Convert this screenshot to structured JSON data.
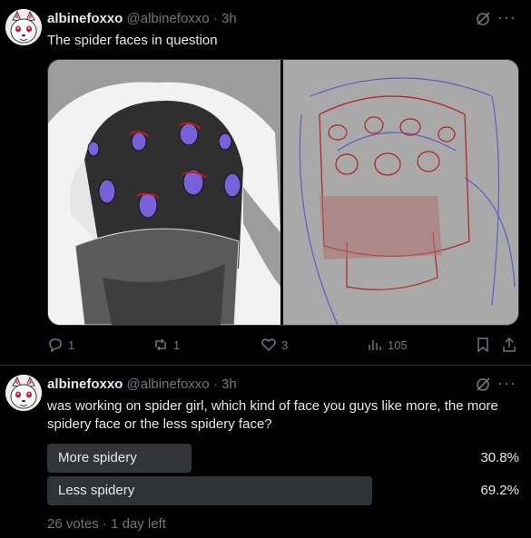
{
  "post1": {
    "author_name": "albinefoxxo",
    "handle": "@albinefoxxo",
    "separator": "·",
    "time": "3h",
    "more_label": "···",
    "text": "The spider faces in question",
    "stats": {
      "replies": "1",
      "reposts": "1",
      "likes": "3",
      "views": "105"
    }
  },
  "post2": {
    "author_name": "albinefoxxo",
    "handle": "@albinefoxxo",
    "separator": "·",
    "time": "3h",
    "more_label": "···",
    "text": "was working on spider girl, which kind of face you guys like more, the more spidery face or the less spidery face?",
    "poll": {
      "options": [
        {
          "label": "More spidery",
          "percent_text": "30.8%",
          "percent": 30.8
        },
        {
          "label": "Less spidery",
          "percent_text": "69.2%",
          "percent": 69.2
        }
      ],
      "votes": "26 votes",
      "separator": "·",
      "time_left": "1 day left"
    }
  },
  "colors": {
    "background": "#000000",
    "text": "#e7e9ea",
    "muted": "#71767b",
    "bar": "#333639"
  }
}
